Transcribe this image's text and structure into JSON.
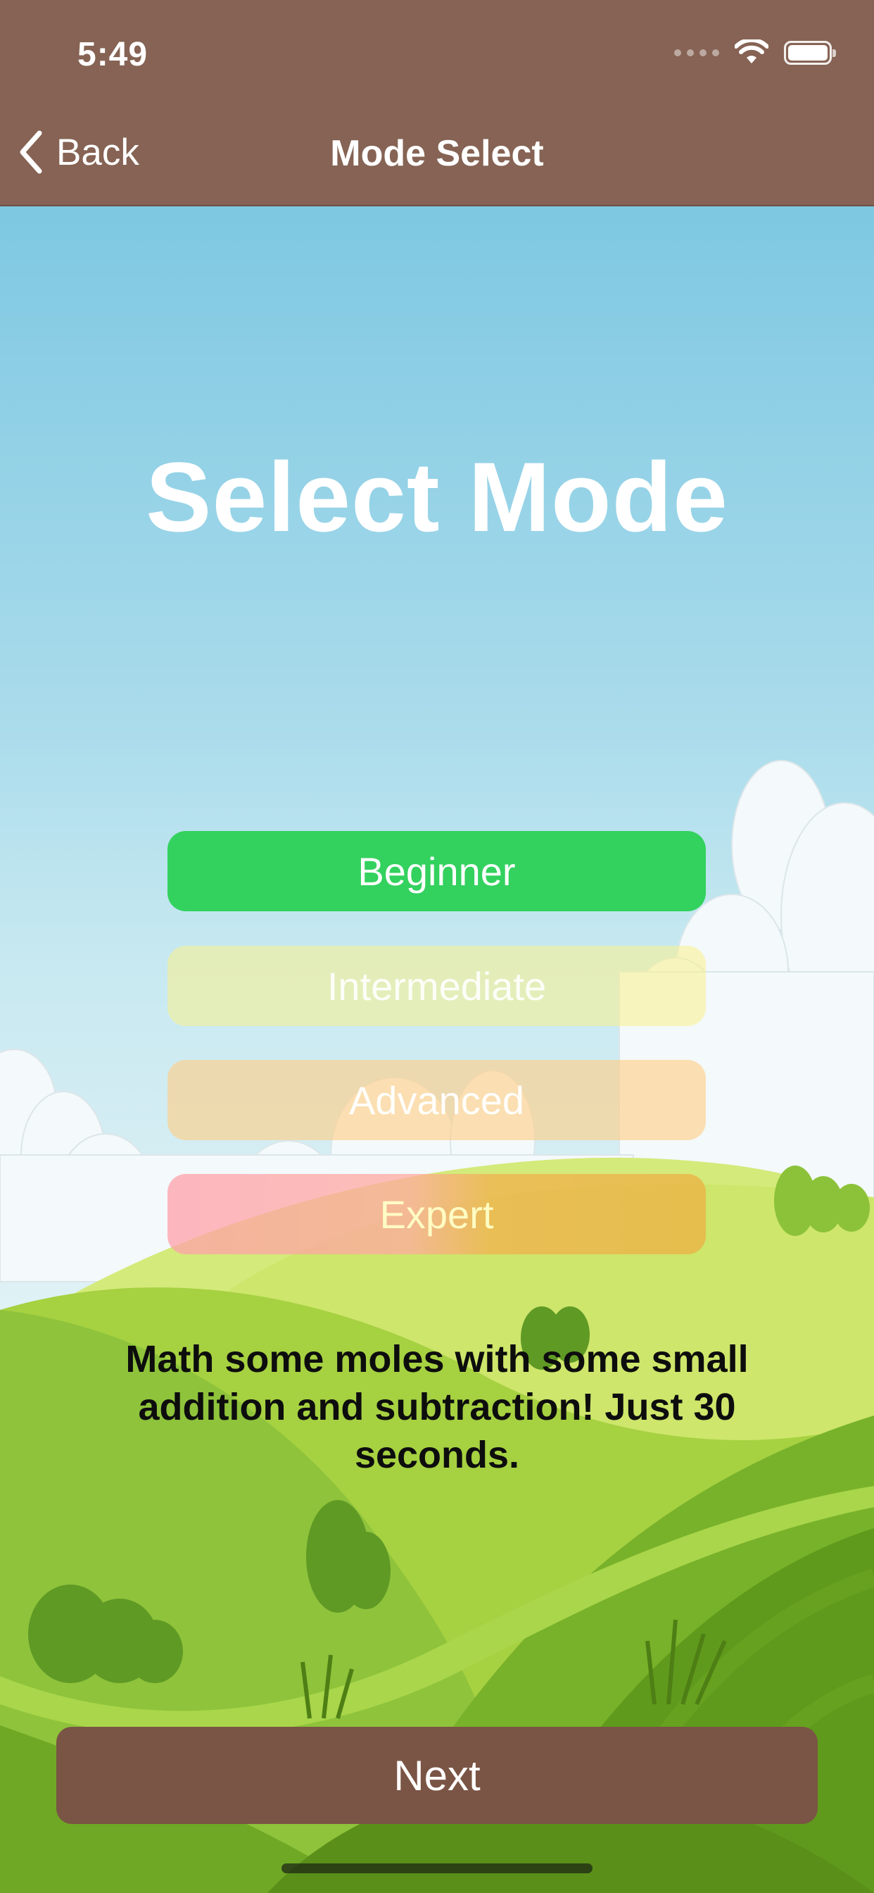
{
  "status_bar": {
    "time": "5:49",
    "icons": [
      "signal-dots-icon",
      "wifi-icon",
      "battery-icon"
    ]
  },
  "nav": {
    "back_label": "Back",
    "title": "Mode Select",
    "back_icon": "chevron-left-icon"
  },
  "main": {
    "heading": "Select Mode",
    "modes": [
      {
        "label": "Beginner",
        "selected": true,
        "color": "#33d15e"
      },
      {
        "label": "Intermediate",
        "selected": false,
        "color": "#faf08c"
      },
      {
        "label": "Advanced",
        "selected": false,
        "color": "#ffcd82"
      },
      {
        "label": "Expert",
        "selected": false,
        "color": "#ffa0aa"
      }
    ],
    "description": "Math some moles with some small addition and subtraction! Just 30 seconds."
  },
  "footer": {
    "next_label": "Next"
  },
  "colors": {
    "nav_bar": "#866354",
    "next_button": "#7a5444",
    "sky_top": "#7ec8e2",
    "grass": "#8cc63f"
  }
}
